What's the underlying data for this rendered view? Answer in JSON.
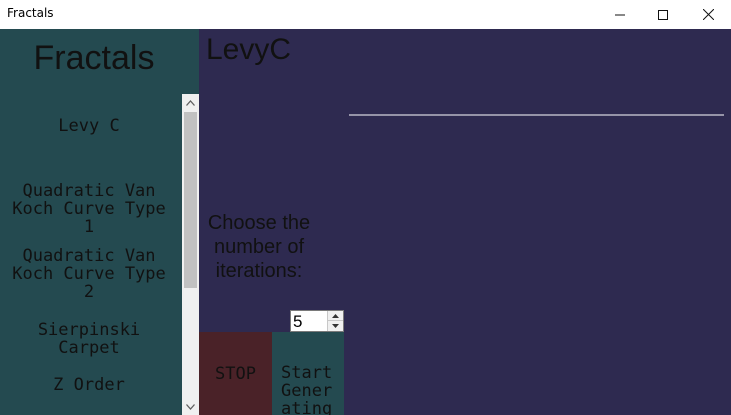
{
  "window": {
    "title": "Fractals",
    "controls": [
      "minimize",
      "maximize",
      "close"
    ]
  },
  "sidebar": {
    "heading": "Fractals",
    "items": [
      {
        "label": "Levy C"
      },
      {
        "label": "Quadratic Van\nKoch Curve Type\n1"
      },
      {
        "label": "Quadratic Van\nKoch Curve Type\n2"
      },
      {
        "label": "Sierpinski\nCarpet"
      },
      {
        "label": "Z Order"
      }
    ]
  },
  "controls_panel": {
    "fractal_name": "LevyC",
    "prompt": "Choose the number of iterations:",
    "iterations_value": "5",
    "stop_label": "STOP",
    "start_label": "Start\nGener\nating"
  },
  "canvas": {
    "fractal": "Levy C curve",
    "line_color": "#ffffff",
    "background": "#2e2a50"
  },
  "colors": {
    "sidebar_bg": "#244a50",
    "panel_bg": "#2e2a50",
    "stop_bg": "#4a2228",
    "start_bg": "#244a50"
  }
}
